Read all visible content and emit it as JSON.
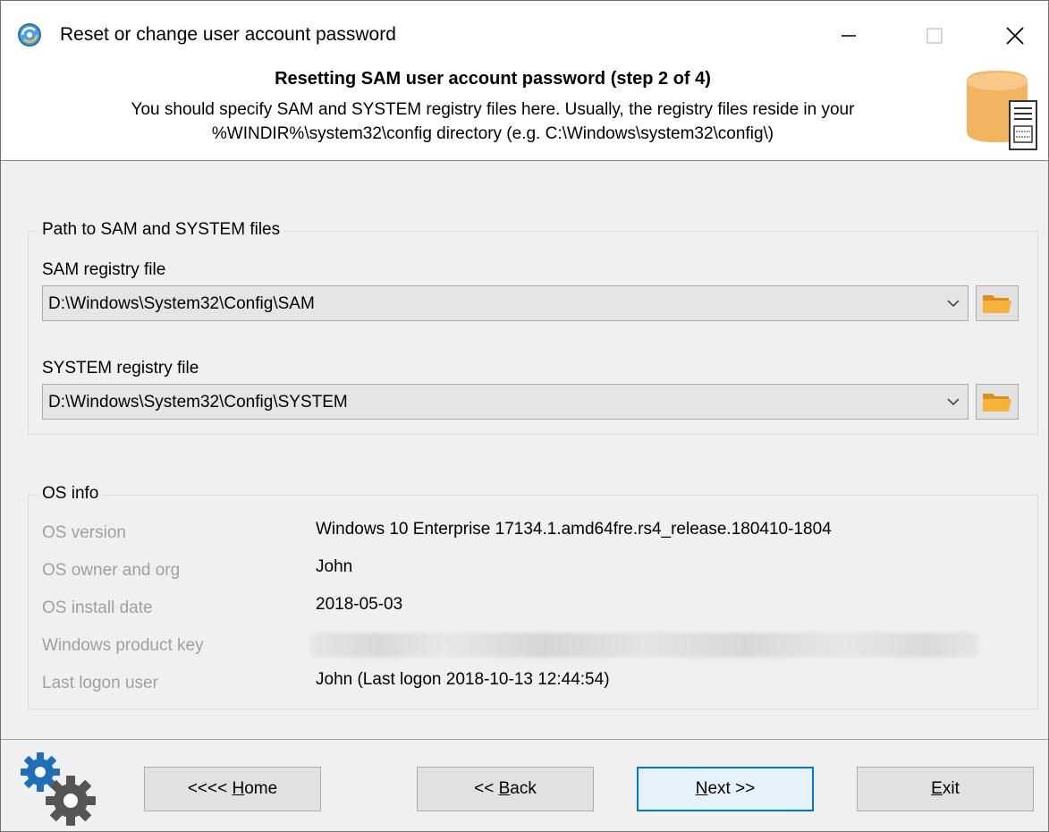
{
  "window": {
    "title": "Reset or change user account password",
    "app_icon": "app-logo-icon",
    "minimize_icon": "minimize-icon",
    "maximize_icon": "maximize-icon",
    "close_icon": "close-icon"
  },
  "header": {
    "title": "Resetting SAM user account password (step 2 of 4)",
    "description_line1": "You should specify SAM and SYSTEM registry files here. Usually, the registry files reside in your",
    "description_line2": "%WINDIR%\\system32\\config directory (e.g. C:\\Windows\\system32\\config\\)",
    "icon": "database-server-icon"
  },
  "path_group": {
    "legend": "Path to SAM and SYSTEM files",
    "sam_label": "SAM registry file",
    "sam_value": "D:\\Windows\\System32\\Config\\SAM",
    "system_label": "SYSTEM registry file",
    "system_value": "D:\\Windows\\System32\\Config\\SYSTEM",
    "browse_icon": "folder-icon",
    "dropdown_icon": "chevron-down-icon"
  },
  "os_info": {
    "legend": "OS info",
    "rows": [
      {
        "label": "OS version",
        "value": "Windows 10 Enterprise 17134.1.amd64fre.rs4_release.180410-1804"
      },
      {
        "label": "OS owner and org",
        "value": "John"
      },
      {
        "label": "OS install date",
        "value": "2018-05-03"
      },
      {
        "label": "Windows product key",
        "value": ""
      },
      {
        "label": "Last logon user",
        "value": "John (Last logon 2018-10-13 12:44:54)"
      }
    ]
  },
  "footer": {
    "gears_icon": "gears-icon",
    "home": {
      "pre": "<<<< ",
      "key": "H",
      "post": "ome"
    },
    "back": {
      "pre": "<< ",
      "key": "B",
      "post": "ack"
    },
    "next": {
      "pre": "",
      "key": "N",
      "post": "ext >>"
    },
    "exit": {
      "pre": "",
      "key": "E",
      "post": "xit"
    }
  },
  "colors": {
    "accent": "#0078d7",
    "db_icon": "#f3b462",
    "folder_icon": "#f0a830",
    "disabled_text": "#a0a0a0",
    "gears": "#1f6fb8",
    "gears_dark": "#555555"
  }
}
